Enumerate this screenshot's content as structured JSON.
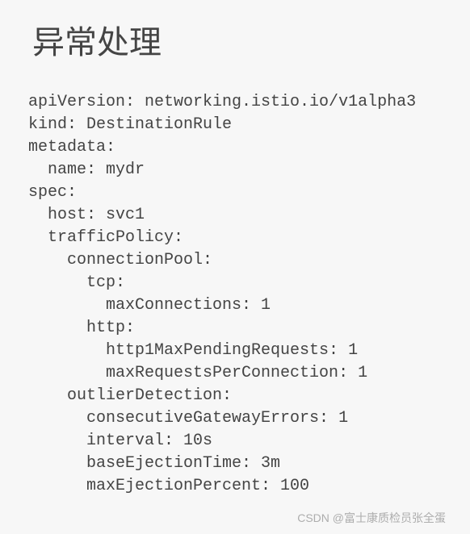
{
  "title": "异常处理",
  "code": {
    "line1": "apiVersion: networking.istio.io/v1alpha3",
    "line2": "kind: DestinationRule",
    "line3": "metadata:",
    "line4": "  name: mydr",
    "line5": "spec:",
    "line6": "  host: svc1",
    "line7": "  trafficPolicy:",
    "line8": "    connectionPool:",
    "line9": "      tcp:",
    "line10": "        maxConnections: 1",
    "line11": "      http:",
    "line12": "        http1MaxPendingRequests: 1",
    "line13": "        maxRequestsPerConnection: 1",
    "line14": "    outlierDetection:",
    "line15": "      consecutiveGatewayErrors: 1",
    "line16": "      interval: 10s",
    "line17": "      baseEjectionTime: 3m",
    "line18": "      maxEjectionPercent: 100"
  },
  "watermark": "CSDN @富士康质检员张全蛋"
}
